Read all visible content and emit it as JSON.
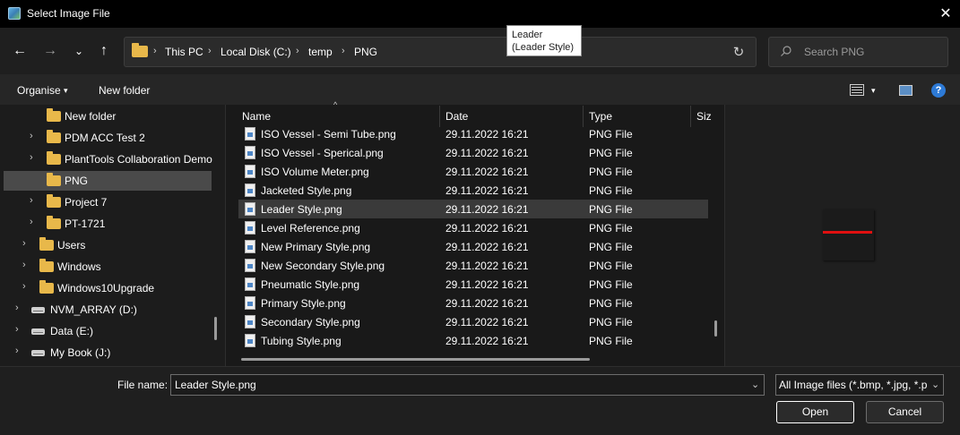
{
  "window": {
    "title": "Select Image File",
    "close_glyph": "✕"
  },
  "nav": {
    "back_glyph": "←",
    "forward_glyph": "→",
    "recent_glyph": "⌄",
    "up_glyph": "↑",
    "breadcrumbs": [
      "This PC",
      "Local Disk (C:)",
      "temp",
      "PNG"
    ],
    "separator": "›",
    "refresh_glyph": "↻",
    "search_placeholder": "Search PNG"
  },
  "toolbar": {
    "organise_label": "Organise",
    "caret": "▾",
    "new_folder_label": "New folder",
    "help_glyph": "?"
  },
  "tree": [
    {
      "label": "New folder",
      "kind": "folder",
      "chevron": ""
    },
    {
      "label": "PDM ACC Test 2",
      "kind": "folder",
      "chevron": "›"
    },
    {
      "label": "PlantTools Collaboration Demo",
      "kind": "folder",
      "chevron": "›"
    },
    {
      "label": "PNG",
      "kind": "folder",
      "chevron": "",
      "selected": true
    },
    {
      "label": "Project 7",
      "kind": "folder",
      "chevron": "›"
    },
    {
      "label": "PT-1721",
      "kind": "folder",
      "chevron": "›"
    },
    {
      "label": "Users",
      "kind": "folder",
      "chevron": "›"
    },
    {
      "label": "Windows",
      "kind": "folder",
      "chevron": "›"
    },
    {
      "label": "Windows10Upgrade",
      "kind": "folder",
      "chevron": "›"
    },
    {
      "label": "NVM_ARRAY (D:)",
      "kind": "drive",
      "chevron": "›"
    },
    {
      "label": "Data (E:)",
      "kind": "drive",
      "chevron": "›"
    },
    {
      "label": "My Book (J:)",
      "kind": "drive",
      "chevron": "›"
    }
  ],
  "columns": {
    "name": "Name",
    "date": "Date",
    "type": "Type",
    "size": "Siz",
    "sort_glyph": "^"
  },
  "files": [
    {
      "name": "ISO Vessel - Semi Tube.png",
      "date": "29.11.2022 16:21",
      "type": "PNG File"
    },
    {
      "name": "ISO Vessel - Sperical.png",
      "date": "29.11.2022 16:21",
      "type": "PNG File"
    },
    {
      "name": "ISO Volume Meter.png",
      "date": "29.11.2022 16:21",
      "type": "PNG File"
    },
    {
      "name": "Jacketed Style.png",
      "date": "29.11.2022 16:21",
      "type": "PNG File"
    },
    {
      "name": "Leader Style.png",
      "date": "29.11.2022 16:21",
      "type": "PNG File",
      "selected": true
    },
    {
      "name": "Level Reference.png",
      "date": "29.11.2022 16:21",
      "type": "PNG File"
    },
    {
      "name": "New Primary Style.png",
      "date": "29.11.2022 16:21",
      "type": "PNG File"
    },
    {
      "name": "New Secondary Style.png",
      "date": "29.11.2022 16:21",
      "type": "PNG File"
    },
    {
      "name": "Pneumatic Style.png",
      "date": "29.11.2022 16:21",
      "type": "PNG File"
    },
    {
      "name": "Primary Style.png",
      "date": "29.11.2022 16:21",
      "type": "PNG File"
    },
    {
      "name": "Secondary Style.png",
      "date": "29.11.2022 16:21",
      "type": "PNG File"
    },
    {
      "name": "Tubing Style.png",
      "date": "29.11.2022 16:21",
      "type": "PNG File"
    }
  ],
  "bottom": {
    "filename_label": "File name:",
    "filename_value": "Leader Style.png",
    "filetype_value": "All Image files (*.bmp, *.jpg, *.png)",
    "dropdown_glyph": "⌄",
    "open_label": "Open",
    "cancel_label": "Cancel"
  },
  "tooltip": {
    "line1": "Leader",
    "line2": "(Leader Style)"
  },
  "colors": {
    "selection": "#4a4a4a",
    "folder": "#e8b84a",
    "preview_line": "#e01010",
    "help_blue": "#2d7ad6"
  }
}
